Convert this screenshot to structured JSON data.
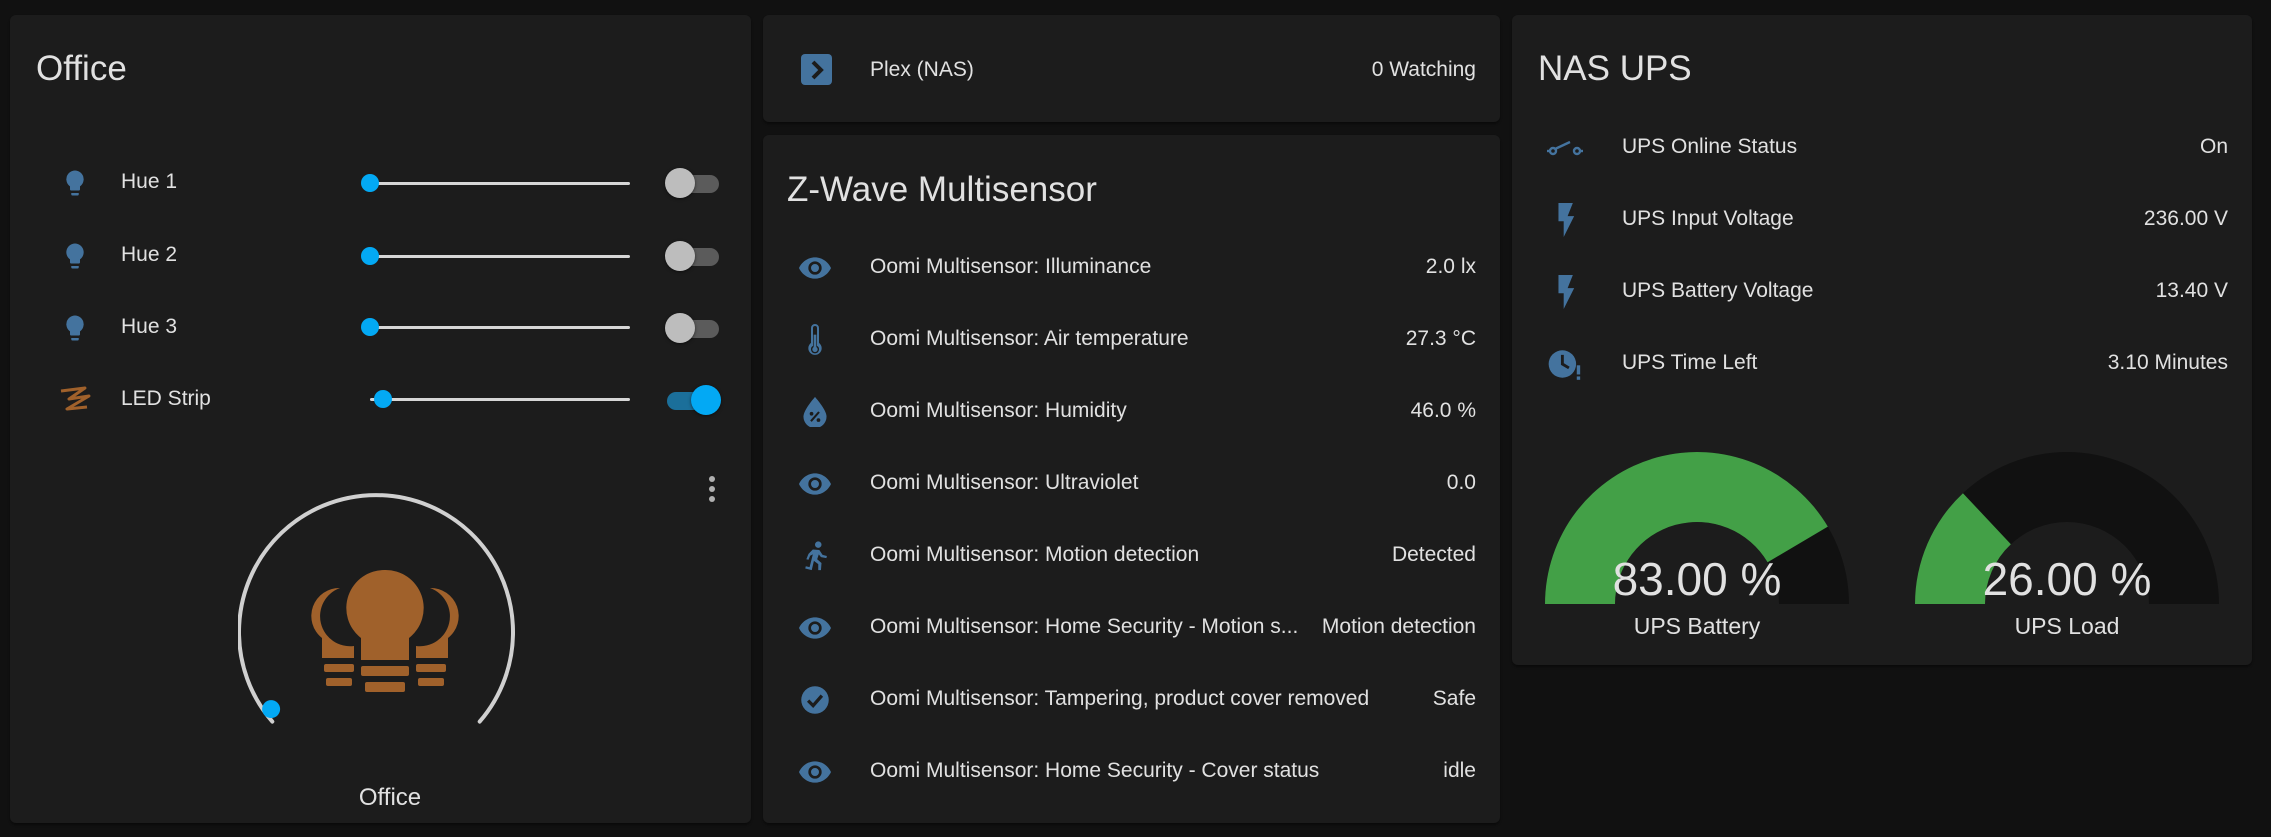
{
  "office": {
    "title": "Office",
    "lights": [
      {
        "label": "Hue 1",
        "icon": "lightbulb-icon",
        "brightness": 0.0,
        "on": false
      },
      {
        "label": "Hue 2",
        "icon": "lightbulb-icon",
        "brightness": 0.0,
        "on": false
      },
      {
        "label": "Hue 3",
        "icon": "lightbulb-icon",
        "brightness": 0.0,
        "on": false
      },
      {
        "label": "LED Strip",
        "icon": "led-strip-icon",
        "brightness": 0.05,
        "on": true
      }
    ],
    "group_light": {
      "name": "Office",
      "icon": "lightbulb-group-icon",
      "brightness": 0.0
    }
  },
  "plex": {
    "label": "Plex (NAS)",
    "value": "0 Watching",
    "icon": "plex-icon"
  },
  "zwave": {
    "title": "Z-Wave Multisensor",
    "rows": [
      {
        "label": "Oomi Multisensor: Illuminance",
        "value": "2.0 lx",
        "icon": "eye-icon"
      },
      {
        "label": "Oomi Multisensor: Air temperature",
        "value": "27.3 °C",
        "icon": "thermometer-icon"
      },
      {
        "label": "Oomi Multisensor: Humidity",
        "value": "46.0 %",
        "icon": "water-percent-icon"
      },
      {
        "label": "Oomi Multisensor: Ultraviolet",
        "value": "0.0",
        "icon": "eye-icon"
      },
      {
        "label": "Oomi Multisensor: Motion detection",
        "value": "Detected",
        "icon": "run-icon"
      },
      {
        "label": "Oomi Multisensor: Home Security - Motion s...",
        "value": "Motion detection",
        "icon": "eye-icon"
      },
      {
        "label": "Oomi Multisensor: Tampering, product cover removed",
        "value": "Safe",
        "icon": "check-circle-icon"
      },
      {
        "label": "Oomi Multisensor: Home Security - Cover status",
        "value": "idle",
        "icon": "eye-icon"
      }
    ]
  },
  "nas_ups": {
    "title": "NAS UPS",
    "rows": [
      {
        "label": "UPS Online Status",
        "value": "On",
        "icon": "switch-icon"
      },
      {
        "label": "UPS Input Voltage",
        "value": "236.00 V",
        "icon": "flash-icon"
      },
      {
        "label": "UPS Battery Voltage",
        "value": "13.40 V",
        "icon": "flash-icon"
      },
      {
        "label": "UPS Time Left",
        "value": "3.10 Minutes",
        "icon": "clock-alert-icon"
      }
    ],
    "gauges": [
      {
        "name": "UPS Battery",
        "display": "83.00 %",
        "value": 83
      },
      {
        "name": "UPS Load",
        "display": "26.00 %",
        "value": 26
      }
    ]
  },
  "colors": {
    "background": "#111111",
    "card": "#1c1c1c",
    "accent": "#03a9f4",
    "icon": "#44739e",
    "light_on": "#a0612b",
    "gauge_fill": "#43a047",
    "gauge_track": "#111111"
  }
}
